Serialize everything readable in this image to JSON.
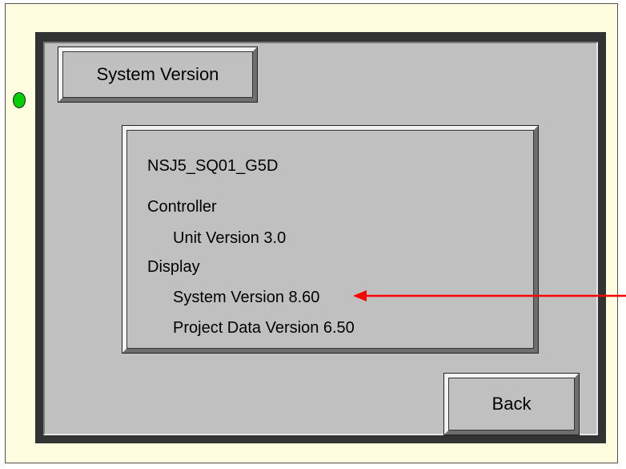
{
  "screen": {
    "title": "System Version"
  },
  "info": {
    "device_id": "NSJ5_SQ01_G5D",
    "controller_heading": "Controller",
    "unit_version": "Unit Version  3.0",
    "display_heading": "Display",
    "system_version": "System Version 8.60",
    "project_data_version": "Project Data Version  6.50"
  },
  "buttons": {
    "back": "Back"
  },
  "colors": {
    "device_body": "#fffde0",
    "screen_background": "#c0c0c0",
    "status_led": "#00d000",
    "annotation_arrow": "#ff0000"
  }
}
